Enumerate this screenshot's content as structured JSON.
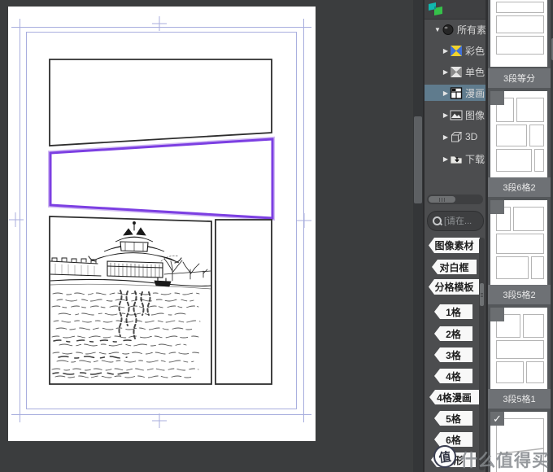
{
  "colors": {
    "app_background": "#3b3d3e",
    "selected_panel_purple": "#7c3fe2",
    "guide_lavender": "#a8aede",
    "selected_tree_row": "#5f7b8d",
    "watermark_gray": "#84888c"
  },
  "palette": {
    "tree": {
      "items": [
        {
          "label": "所有素材",
          "expander": "▼",
          "icon": "all-materials-icon",
          "selected": false
        },
        {
          "label": "彩色",
          "expander": "▶",
          "icon": "color-pinwheel-icon",
          "selected": false
        },
        {
          "label": "单色",
          "expander": "▶",
          "icon": "mono-pinwheel-icon",
          "selected": false
        },
        {
          "label": "漫画",
          "expander": "▶",
          "icon": "comic-panels-icon",
          "selected": true
        },
        {
          "label": "图像",
          "expander": "▶",
          "icon": "image-icon",
          "selected": false
        },
        {
          "label": "3D",
          "expander": "▶",
          "icon": "cube-3d-icon",
          "selected": false
        },
        {
          "label": "下载",
          "expander": "▶",
          "icon": "download-folder-icon",
          "selected": false
        }
      ]
    },
    "search": {
      "placeholder": "[请在...",
      "icon": "search-icon"
    },
    "tags": [
      "图像素材",
      "对白框",
      "分格模板",
      "1格",
      "2格",
      "3格",
      "4格",
      "4格漫画",
      "5格",
      "6格",
      "云形"
    ]
  },
  "thumbnails": {
    "check_glyph": "✓",
    "items": [
      {
        "label": "3段等分",
        "checked": false
      },
      {
        "label": "3段6格2",
        "checked": false
      },
      {
        "label": "3段5格2",
        "checked": false
      },
      {
        "label": "3段5格1",
        "checked": false
      },
      {
        "label": "",
        "checked": true
      }
    ]
  },
  "watermark": {
    "logo_char": "值",
    "text": "什么值得买"
  }
}
